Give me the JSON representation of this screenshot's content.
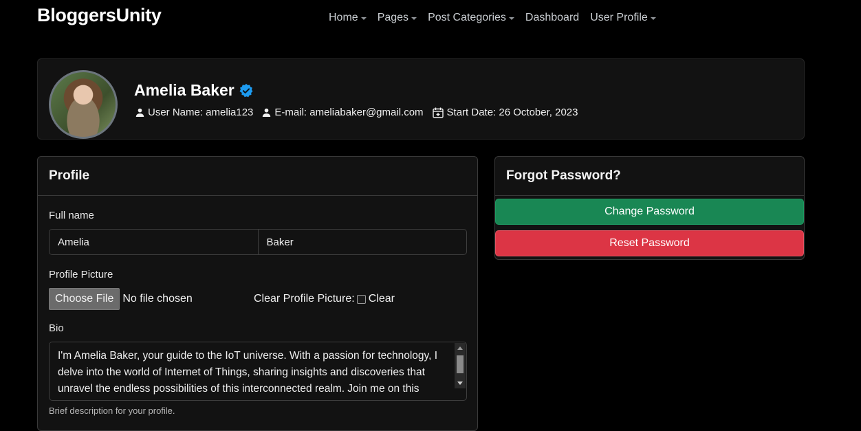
{
  "brand": "BloggersUnity",
  "nav": {
    "items": [
      {
        "label": "Home",
        "dropdown": true
      },
      {
        "label": "Pages",
        "dropdown": true
      },
      {
        "label": "Post Categories",
        "dropdown": true
      },
      {
        "label": "Dashboard",
        "dropdown": false
      },
      {
        "label": "User Profile",
        "dropdown": true
      }
    ]
  },
  "profile": {
    "name": "Amelia Baker",
    "username": "User Name: amelia123",
    "email": "E-mail: ameliabaker@gmail.com",
    "start_date": "Start Date: 26 October, 2023",
    "verified_color": "#1d9bf0"
  },
  "profile_card": {
    "title": "Profile",
    "full_name_label": "Full name",
    "first_name": "Amelia",
    "last_name": "Baker",
    "picture_label": "Profile Picture",
    "choose_file": "Choose File",
    "no_file": "No file chosen",
    "clear_label": "Clear Profile Picture:",
    "clear_checkbox_label": "Clear",
    "bio_label": "Bio",
    "bio_text": "I'm Amelia Baker, your guide to the IoT universe. With a passion for technology, I delve into the world of Internet of Things, sharing insights and discoveries that unravel the endless possibilities of this interconnected realm. Join me on this",
    "bio_help": "Brief description for your profile."
  },
  "password_card": {
    "title": "Forgot Password?",
    "change_label": "Change Password",
    "reset_label": "Reset Password"
  },
  "colors": {
    "background": "#000000",
    "card": "#121212",
    "success": "#198754",
    "danger": "#dc3545"
  }
}
